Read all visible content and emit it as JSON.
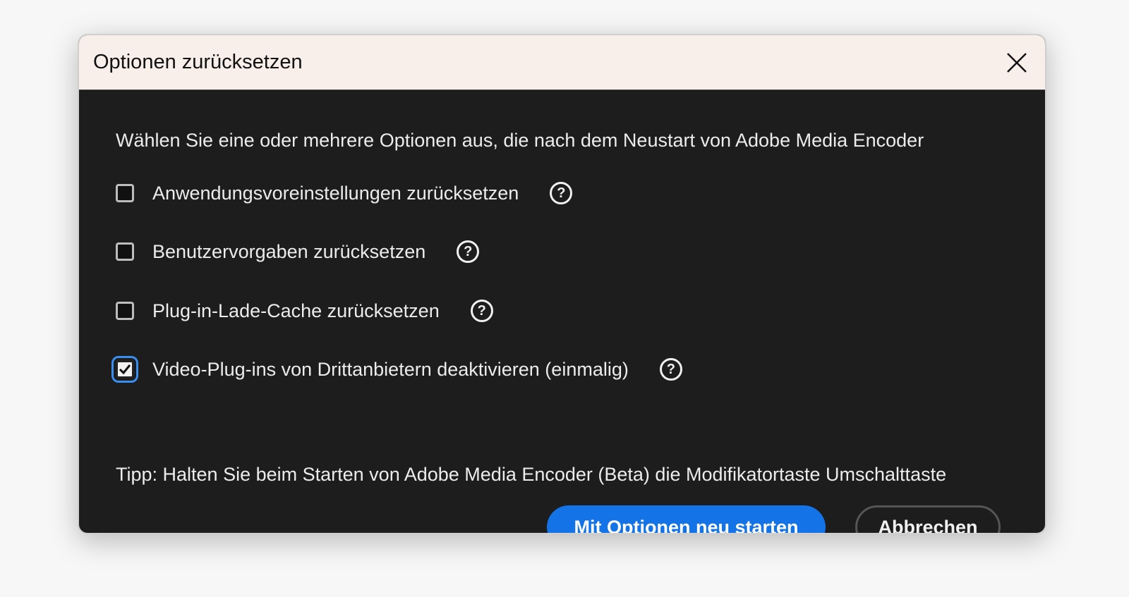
{
  "dialog": {
    "title": "Optionen zurücksetzen",
    "description": "Wählen Sie eine oder mehrere Optionen aus, die nach dem Neustart von Adobe Media Encoder",
    "options": [
      {
        "label": "Anwendungsvoreinstellungen zurücksetzen",
        "checked": false
      },
      {
        "label": "Benutzervorgaben zurücksetzen",
        "checked": false
      },
      {
        "label": "Plug-in-Lade-Cache zurücksetzen",
        "checked": false
      },
      {
        "label": "Video-Plug-ins von Drittanbietern deaktivieren (einmalig)",
        "checked": true
      }
    ],
    "help_glyph": "?",
    "tip": "Tipp: Halten Sie beim Starten von Adobe Media Encoder (Beta) die Modifikatortaste Umschalttaste",
    "primary_button": "Mit Optionen neu starten",
    "cancel_button": "Abbrechen"
  },
  "colors": {
    "accent": "#1473e6",
    "body_bg": "#1d1d1d",
    "titlebar_bg": "#f8efeb"
  }
}
